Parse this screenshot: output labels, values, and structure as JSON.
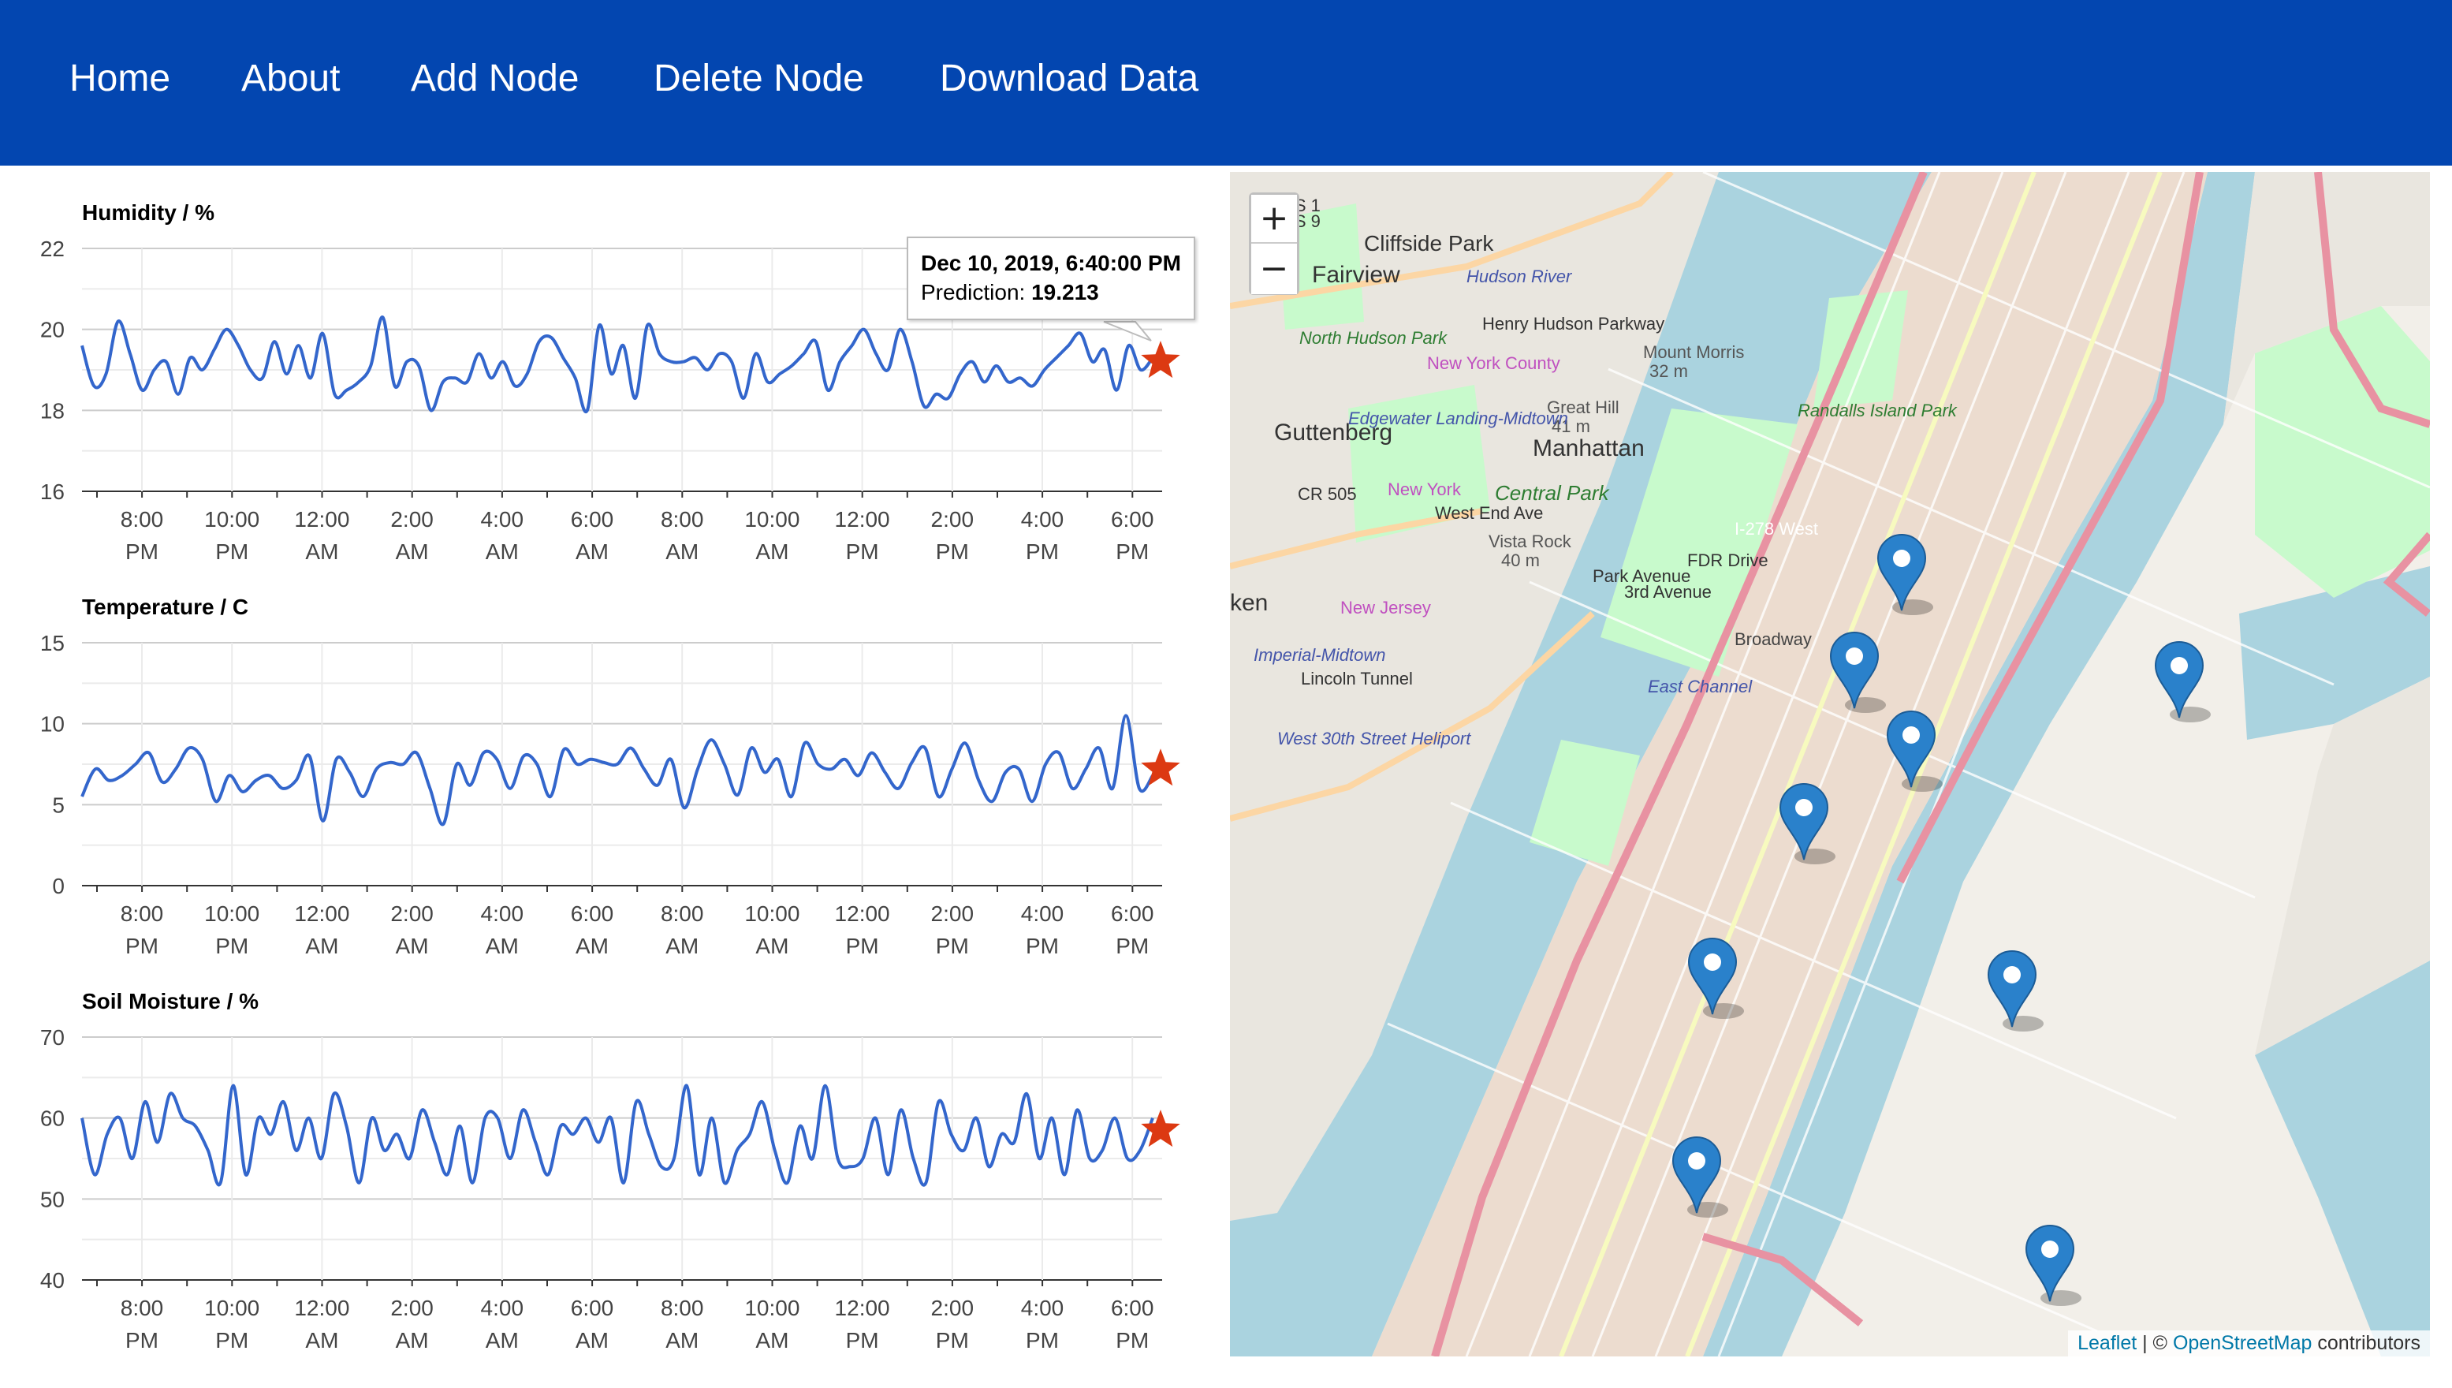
{
  "nav": {
    "items": [
      "Home",
      "About",
      "Add Node",
      "Delete Node",
      "Download Data"
    ]
  },
  "colors": {
    "navbar": "#0346b0",
    "line": "#3366cc",
    "prediction_star": "#dc3912",
    "map_water": "#aad3df",
    "map_park": "#c8facc",
    "marker": "#2a81cb"
  },
  "charts": [
    {
      "title": "Humidity / %",
      "yticks": [
        "22",
        "20",
        "18",
        "16"
      ],
      "xticks": [
        [
          "8:00",
          "PM"
        ],
        [
          "10:00",
          "PM"
        ],
        [
          "12:00",
          "AM"
        ],
        [
          "2:00",
          "AM"
        ],
        [
          "4:00",
          "AM"
        ],
        [
          "6:00",
          "AM"
        ],
        [
          "8:00",
          "AM"
        ],
        [
          "10:00",
          "AM"
        ],
        [
          "12:00",
          "PM"
        ],
        [
          "2:00",
          "PM"
        ],
        [
          "4:00",
          "PM"
        ],
        [
          "6:00",
          "PM"
        ]
      ]
    },
    {
      "title": "Temperature / C",
      "yticks": [
        "15",
        "10",
        "5",
        "0"
      ],
      "xticks": [
        [
          "8:00",
          "PM"
        ],
        [
          "10:00",
          "PM"
        ],
        [
          "12:00",
          "AM"
        ],
        [
          "2:00",
          "AM"
        ],
        [
          "4:00",
          "AM"
        ],
        [
          "6:00",
          "AM"
        ],
        [
          "8:00",
          "AM"
        ],
        [
          "10:00",
          "AM"
        ],
        [
          "12:00",
          "PM"
        ],
        [
          "2:00",
          "PM"
        ],
        [
          "4:00",
          "PM"
        ],
        [
          "6:00",
          "PM"
        ]
      ]
    },
    {
      "title": "Soil Moisture / %",
      "yticks": [
        "70",
        "60",
        "50",
        "40"
      ],
      "xticks": [
        [
          "8:00",
          "PM"
        ],
        [
          "10:00",
          "PM"
        ],
        [
          "12:00",
          "AM"
        ],
        [
          "2:00",
          "AM"
        ],
        [
          "4:00",
          "AM"
        ],
        [
          "6:00",
          "AM"
        ],
        [
          "8:00",
          "AM"
        ],
        [
          "10:00",
          "AM"
        ],
        [
          "12:00",
          "PM"
        ],
        [
          "2:00",
          "PM"
        ],
        [
          "4:00",
          "PM"
        ],
        [
          "6:00",
          "PM"
        ]
      ]
    }
  ],
  "tooltip": {
    "date": "Dec 10, 2019, 6:40:00 PM",
    "label": "Prediction: ",
    "value": "19.213"
  },
  "chart_data": [
    {
      "type": "line",
      "title": "Humidity / %",
      "ylim": [
        16,
        22
      ],
      "x_range": [
        "Dec 9, 2019, 6:40 PM",
        "Dec 10, 2019, 6:20 PM"
      ],
      "series": [
        {
          "values": [
            19.6,
            18.6,
            18.9,
            20.2,
            19.4,
            18.5,
            19.0,
            19.2,
            18.4,
            19.3,
            19.0,
            19.5,
            20.0,
            19.6,
            19.0,
            18.8,
            19.7,
            18.9,
            19.6,
            18.8,
            19.9,
            18.4,
            18.5,
            18.7,
            19.1,
            20.3,
            18.6,
            19.2,
            19.1,
            18.0,
            18.7,
            18.8,
            18.7,
            19.4,
            18.8,
            19.2,
            18.6,
            18.9,
            19.7,
            19.8,
            19.3,
            18.8,
            18.0,
            20.1,
            18.9,
            19.6,
            18.3,
            20.1,
            19.4,
            19.2,
            19.2,
            19.3,
            19.0,
            19.4,
            19.2,
            18.3,
            19.4,
            18.7,
            18.9,
            19.1,
            19.4,
            19.7,
            18.5,
            19.2,
            19.6,
            20.0,
            19.4,
            19.0,
            20.0,
            19.2,
            18.1,
            18.4,
            18.3,
            18.9,
            19.2,
            18.7,
            19.1,
            18.7,
            18.8,
            18.6,
            19.0,
            19.3,
            19.6,
            19.9,
            19.2,
            19.5,
            18.5,
            19.6,
            19.0,
            19.3
          ]
        }
      ],
      "prediction": {
        "x": "Dec 10, 2019, 6:40:00 PM",
        "value": 19.213
      }
    },
    {
      "type": "line",
      "title": "Temperature / C",
      "ylim": [
        0,
        15
      ],
      "x_range": [
        "Dec 9, 2019, 6:40 PM",
        "Dec 10, 2019, 6:20 PM"
      ],
      "series": [
        {
          "values": [
            5.5,
            7.2,
            6.5,
            6.8,
            7.5,
            8.2,
            6.4,
            7.2,
            8.5,
            7.8,
            5.2,
            6.8,
            5.8,
            6.5,
            6.8,
            6.0,
            6.5,
            8.0,
            4.0,
            7.8,
            7.0,
            5.5,
            7.2,
            7.6,
            7.5,
            8.2,
            6.0,
            3.8,
            7.5,
            6.2,
            8.2,
            7.8,
            6.0,
            8.0,
            7.5,
            5.5,
            8.4,
            7.5,
            7.8,
            7.6,
            7.5,
            8.5,
            7.2,
            6.2,
            7.8,
            4.8,
            7.2,
            9.0,
            7.5,
            5.6,
            8.5,
            7.0,
            7.8,
            5.5,
            8.8,
            7.5,
            7.2,
            7.8,
            6.8,
            8.2,
            7.0,
            6.0,
            7.6,
            8.5,
            5.5,
            7.2,
            8.8,
            6.5,
            5.2,
            7.0,
            7.2,
            5.2,
            7.5,
            8.2,
            6.0,
            7.2,
            8.5,
            6.0,
            10.5,
            6.0,
            6.8
          ]
        }
      ],
      "prediction": {
        "x": "Dec 10, 2019, 6:40:00 PM",
        "value": 7.2
      }
    },
    {
      "type": "line",
      "title": "Soil Moisture / %",
      "ylim": [
        40,
        70
      ],
      "x_range": [
        "Dec 9, 2019, 6:40 PM",
        "Dec 10, 2019, 6:20 PM"
      ],
      "series": [
        {
          "values": [
            60,
            53,
            58,
            60,
            55,
            62,
            57,
            63,
            60,
            59,
            56,
            52,
            64,
            53,
            60,
            58,
            62,
            56,
            60,
            55,
            63,
            59,
            52,
            60,
            56,
            58,
            55,
            61,
            57,
            53,
            59,
            52,
            60,
            60,
            55,
            61,
            57,
            53,
            59,
            58,
            60,
            57,
            60,
            52,
            62,
            58,
            54,
            55,
            64,
            53,
            60,
            52,
            56,
            58,
            62,
            56,
            52,
            59,
            55,
            64,
            55,
            54,
            55,
            60,
            53,
            61,
            55,
            52,
            62,
            58,
            56,
            60,
            54,
            58,
            57,
            63,
            55,
            60,
            53,
            61,
            55,
            56,
            60,
            55,
            56,
            60
          ]
        }
      ],
      "prediction": {
        "x": "Dec 10, 2019, 6:40:00 PM",
        "value": 58.5
      }
    }
  ],
  "map": {
    "zoom_in": "+",
    "zoom_out": "−",
    "marker_count": 9,
    "labels": {
      "cliffside_park": "Cliffside Park",
      "fairview": "Fairview",
      "guttenberg": "Guttenberg",
      "north_hudson_park": "North Hudson Park",
      "manhattan": "Manhattan",
      "central_park": "Central Park",
      "vista_rock": "Vista Rock",
      "vista_rock_elev": "40 m",
      "great_hill": "Great Hill",
      "great_hill_elev": "41 m",
      "mount_morris": "Mount Morris",
      "mount_morris_elev": "32 m",
      "randalls_island": "Randalls Island Park",
      "hudson_river": "Hudson River",
      "henry_hudson_pkwy": "Henry Hudson Parkway",
      "new_york_county": "New York County",
      "new_york": "New York",
      "new_jersey": "New Jersey",
      "edgewater_landing": "Edgewater Landing-Midtown",
      "imperial_midtown": "Imperial-Midtown",
      "us1": "US 1",
      "us9": "US 9",
      "cr505": "CR 505",
      "i278": "I-278 West",
      "ken": "ken",
      "lincoln_tunnel": "Lincoln Tunnel",
      "heliport": "West 30th Street Heliport",
      "east_channel": "East Channel",
      "fdr_drive": "FDR Drive",
      "broadway": "Broadway",
      "park_avenue": "Park Avenue",
      "third_avenue": "3rd Avenue",
      "west_end_ave": "West End Ave"
    },
    "attribution": {
      "leaflet": "Leaflet",
      "sep": " | © ",
      "osm": "OpenStreetMap",
      "contributors": " contributors"
    }
  }
}
